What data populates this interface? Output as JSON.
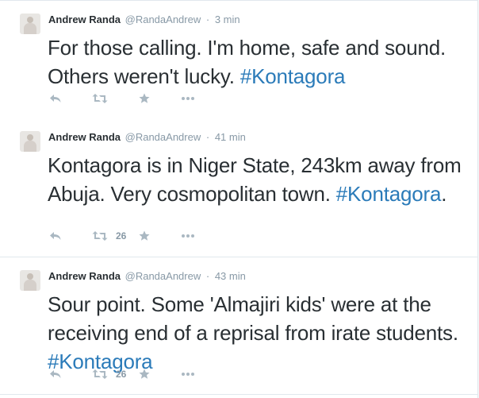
{
  "tweets": [
    {
      "name": "Andrew Randa",
      "handle": "@RandaAndrew",
      "separator": "·",
      "time": "3 min",
      "text": "For those calling. I'm home, safe and sound. Others weren't lucky. ",
      "hashtag": "#Kontagora",
      "text_after": "",
      "retweets": ""
    },
    {
      "name": "Andrew Randa",
      "handle": "@RandaAndrew",
      "separator": "·",
      "time": "41 min",
      "text": "Kontagora is in Niger State, 243km away from Abuja. Very cosmopolitan town. ",
      "hashtag": "#Kontagora",
      "text_after": ".",
      "retweets": "26"
    },
    {
      "name": "Andrew Randa",
      "handle": "@RandaAndrew",
      "separator": "·",
      "time": "43 min",
      "text": "Sour point. Some 'Almajiri kids' were at the receiving end of a reprisal from irate students. ",
      "hashtag": "#Kontagora",
      "text_after": "",
      "retweets": "26"
    }
  ],
  "icons": {
    "reply": "reply-icon",
    "retweet": "retweet-icon",
    "favorite": "star-icon",
    "more": "more-icon"
  },
  "colors": {
    "hashtag": "#2b7bb9",
    "meta": "#8899a6",
    "action_icon": "#aab8c2",
    "text": "#292f33"
  }
}
